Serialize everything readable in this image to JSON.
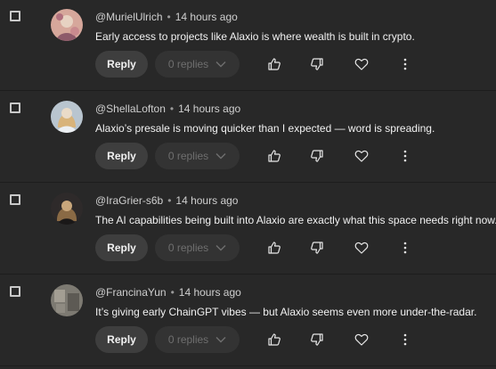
{
  "comments": [
    {
      "handle": "@MurielUlrich",
      "separator": "•",
      "time": "14 hours ago",
      "text": "Early access to projects like Alaxio is where wealth is built in crypto.",
      "reply_label": "Reply",
      "replies_label": "0 replies",
      "avatar_colors": [
        "#d6a79b",
        "#8e5a6a",
        "#e7d2c2"
      ]
    },
    {
      "handle": "@ShellaLofton",
      "separator": "•",
      "time": "14 hours ago",
      "text": "Alaxio’s presale is moving quicker than I expected — word is spreading.",
      "reply_label": "Reply",
      "replies_label": "0 replies",
      "avatar_colors": [
        "#b9c5cf",
        "#d8b37a",
        "#eceff2"
      ]
    },
    {
      "handle": "@IraGrier-s6b",
      "separator": "•",
      "time": "14 hours ago",
      "text": "The AI capabilities being built into Alaxio are exactly what this space needs right now.",
      "reply_label": "Reply",
      "replies_label": "0 replies",
      "avatar_colors": [
        "#2e2a2a",
        "#c9a77c",
        "#1a1818"
      ]
    },
    {
      "handle": "@FrancinaYun",
      "separator": "•",
      "time": "14 hours ago",
      "text": "It’s giving early ChainGPT vibes — but Alaxio seems even more under-the-radar.",
      "reply_label": "Reply",
      "replies_label": "0 replies",
      "avatar_colors": [
        "#7d7a72",
        "#a39e93",
        "#5d5a54"
      ]
    }
  ],
  "icons": {
    "like": "thumbs-up-icon",
    "dislike": "thumbs-down-icon",
    "heart": "heart-icon",
    "more": "more-vertical-icon",
    "chevron": "chevron-down-icon"
  },
  "colors": {
    "background": "#282828",
    "reply_button": "#3e3e3e",
    "replies_button": "#333333",
    "muted_text": "#6f6f6f"
  }
}
